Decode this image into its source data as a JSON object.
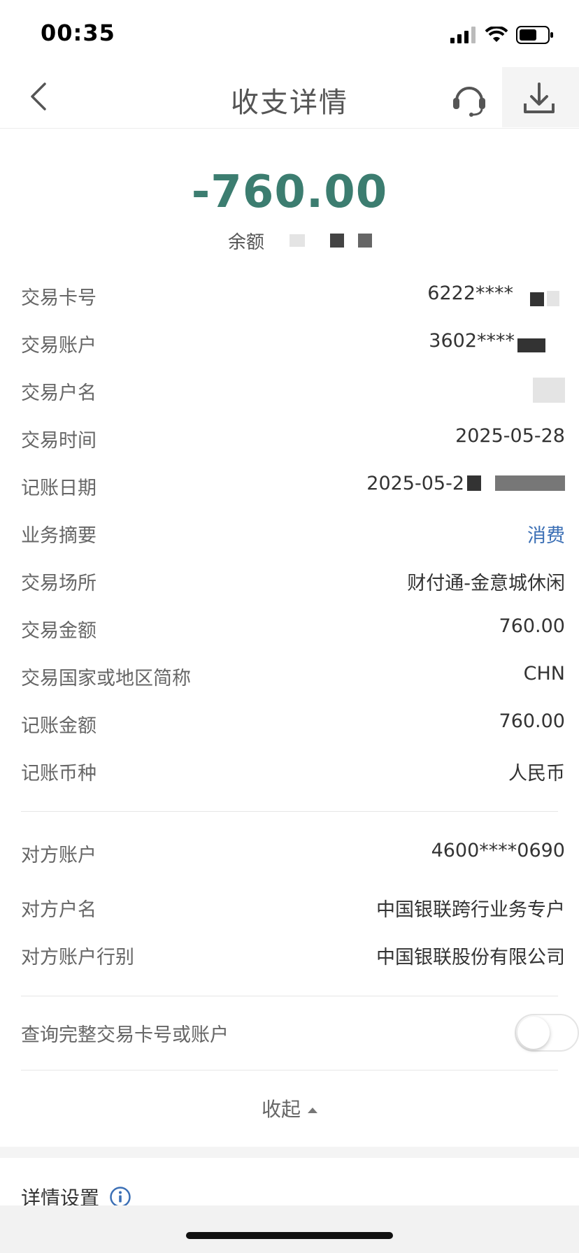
{
  "status_bar": {
    "time": "00:35"
  },
  "nav": {
    "title": "收支详情",
    "back_icon": "chevron-left-icon",
    "support_icon": "headset-icon",
    "download_icon": "download-icon"
  },
  "summary": {
    "amount": "-760.00",
    "balance_label": "余额"
  },
  "details": [
    {
      "label": "交易卡号",
      "value": "6222****"
    },
    {
      "label": "交易账户",
      "value": "3602****"
    },
    {
      "label": "交易户名",
      "value": ""
    },
    {
      "label": "交易时间",
      "value": "2025-05-28"
    },
    {
      "label": "记账日期",
      "value": "2025-05-2"
    },
    {
      "label": "业务摘要",
      "value": "消费"
    },
    {
      "label": "交易场所",
      "value": "财付通-金意城休闲"
    },
    {
      "label": "交易金额",
      "value": "760.00"
    },
    {
      "label": "交易国家或地区简称",
      "value": "CHN"
    },
    {
      "label": "记账金额",
      "value": "760.00"
    },
    {
      "label": "记账币种",
      "value": "人民币"
    }
  ],
  "counterparty": [
    {
      "label": "对方账户",
      "value": "4600****0690"
    },
    {
      "label": "对方户名",
      "value": "中国银联跨行业务专户"
    },
    {
      "label": "对方账户行别",
      "value": "中国银联股份有限公司"
    }
  ],
  "toggle": {
    "label": "查询完整交易卡号或账户",
    "on": false
  },
  "collapse_label": "收起",
  "details_settings": "详情设置",
  "colors": {
    "amount": "#3c7d70",
    "link": "#3b6fb5"
  }
}
